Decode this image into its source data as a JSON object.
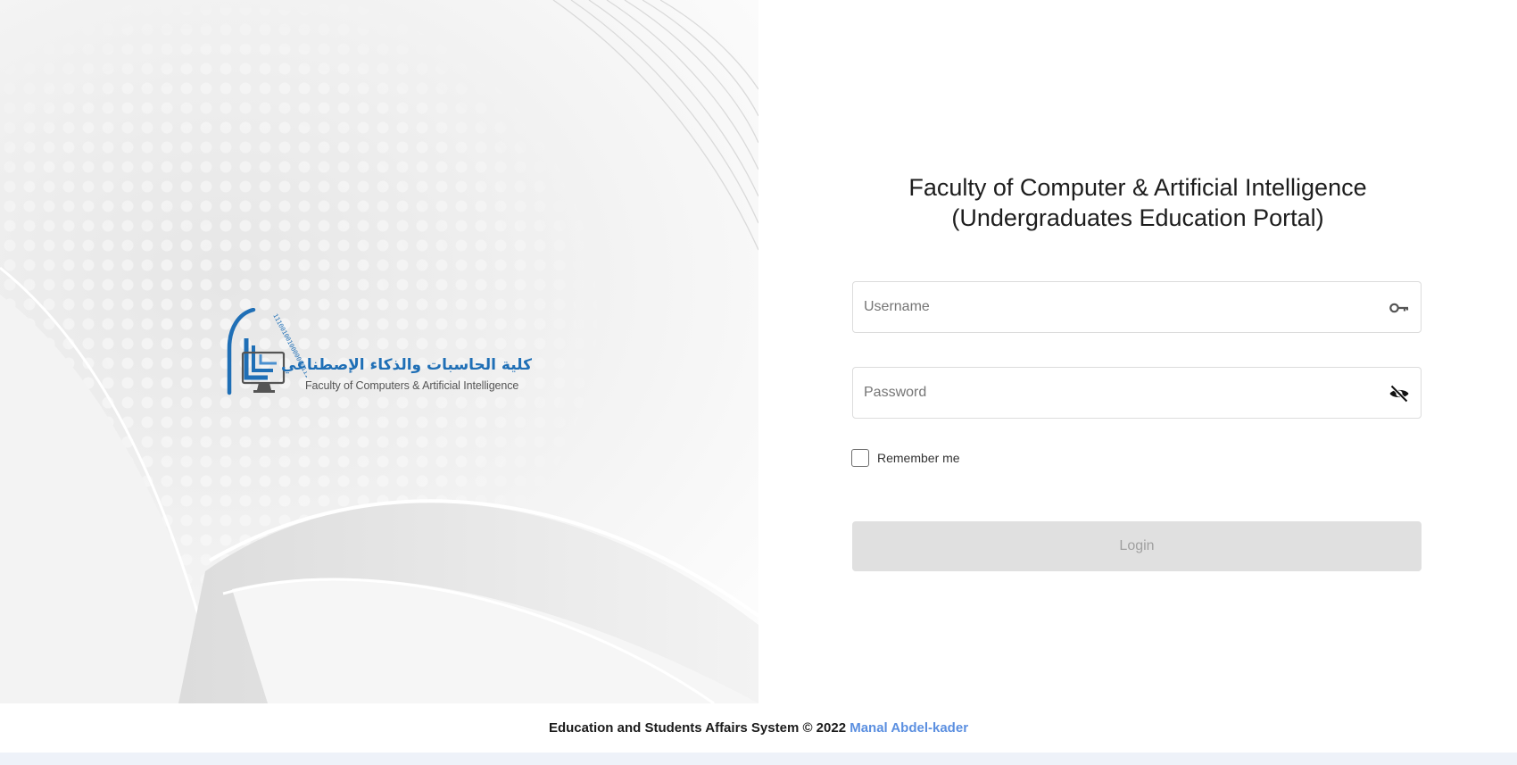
{
  "branding": {
    "logo_arabic": "كلية الحاسبات والذكاء الإصطناعي",
    "logo_english": "Faculty of Computers & Artificial Intelligence",
    "logo_binary": "11100100100000001111010",
    "brand_color": "#1f6fb6"
  },
  "login": {
    "title_line1": "Faculty of Computer & Artificial Intelligence",
    "title_line2": "(Undergraduates Education Portal)",
    "username_placeholder": "Username",
    "password_placeholder": "Password",
    "remember_label": "Remember me",
    "login_label": "Login",
    "username_icon": "key-icon",
    "password_icon": "eye-off-icon"
  },
  "footer": {
    "text": "Education and Students Affairs System © 2022",
    "author_link": "Manal Abdel-kader",
    "link_color": "#5b8fe0"
  }
}
